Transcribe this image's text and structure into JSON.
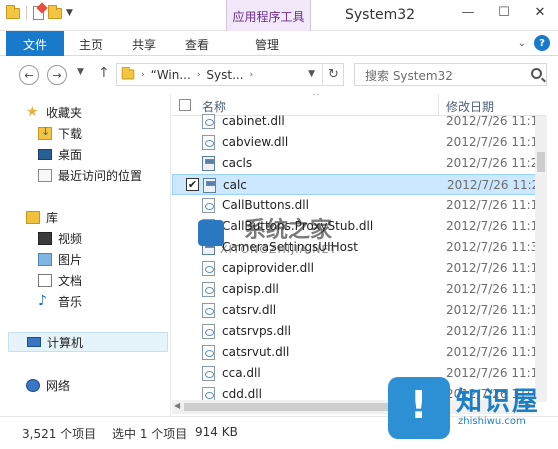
{
  "titlebar": {
    "context_tab": "应用程序工具",
    "window_title": "System32",
    "controls": [
      "—",
      "☐",
      "✕"
    ]
  },
  "ribbon": {
    "tabs": [
      "文件",
      "主页",
      "共享",
      "查看",
      "管理"
    ],
    "expand_icon": "chevron-down-icon",
    "help_icon": "help-icon",
    "help_label": "?"
  },
  "addressbar": {
    "back_icon": "back-arrow-icon",
    "forward_icon": "forward-arrow-icon",
    "path": [
      "“Win...",
      "Syst..."
    ],
    "search_placeholder": "搜索 System32"
  },
  "sidebar": {
    "favorites": "收藏夹",
    "items": [
      "下载",
      "桌面",
      "最近访问的位置"
    ],
    "library": "库",
    "library_items": [
      "视频",
      "图片",
      "文档",
      "音乐"
    ],
    "computer": "计算机",
    "network": "网络"
  },
  "filelist": {
    "columns": {
      "name": "名称",
      "date": "修改日期"
    },
    "rows": [
      {
        "name": "cabinet.dll",
        "date": "2012/7/26 11:1",
        "icon": "dll"
      },
      {
        "name": "cabview.dll",
        "date": "2012/7/26 11:1",
        "icon": "dll"
      },
      {
        "name": "cacls",
        "date": "2012/7/26 11:2",
        "icon": "app"
      },
      {
        "name": "calc",
        "date": "2012/7/26 11:2",
        "icon": "app",
        "selected": true
      },
      {
        "name": "CallButtons.dll",
        "date": "2012/7/26 11:1",
        "icon": "dll"
      },
      {
        "name": "CallButtons.ProxyStub.dll",
        "date": "2012/7/26 11:1",
        "icon": "dll"
      },
      {
        "name": "CameraSettingsUIHost",
        "date": "2012/7/26 11:3",
        "icon": "app"
      },
      {
        "name": "capiprovider.dll",
        "date": "2012/7/26 11:1",
        "icon": "dll"
      },
      {
        "name": "capisp.dll",
        "date": "2012/7/26 11:1",
        "icon": "dll"
      },
      {
        "name": "catsrv.dll",
        "date": "2012/7/26 11:1",
        "icon": "dll"
      },
      {
        "name": "catsrvps.dll",
        "date": "2012/7/26 11:1",
        "icon": "dll"
      },
      {
        "name": "catsrvut.dll",
        "date": "2012/7/26 11:1",
        "icon": "dll"
      },
      {
        "name": "cca.dll",
        "date": "2012/7/26 11:1",
        "icon": "dll"
      },
      {
        "name": "cdd.dll",
        "date": "2012/7/26 11:1",
        "icon": "dll"
      },
      {
        "name": "",
        "date": "2012/7/26 11:1",
        "icon": "dll"
      }
    ]
  },
  "status": {
    "count": "3,521 个项目",
    "selected": "选中 1 个项目",
    "size": "914 KB"
  },
  "watermark": {
    "main": "系统之家",
    "sub": "XITONGZHIJIA.NET"
  },
  "logo": {
    "text": "知识屋",
    "url": "zhishiwu.com"
  },
  "colors": {
    "accent": "#1979ca",
    "selection": "#cce8ff",
    "context_tab": "#f3e7fa"
  }
}
